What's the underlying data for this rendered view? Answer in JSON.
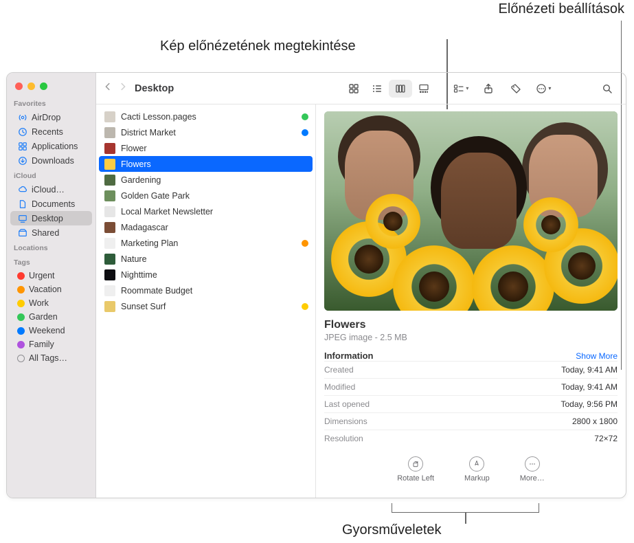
{
  "callouts": {
    "preview_settings": "Előnézeti beállítások",
    "image_preview": "Kép előnézetének megtekintése",
    "quick_actions": "Gyorsműveletek"
  },
  "window": {
    "title": "Desktop"
  },
  "sidebar": {
    "sections": {
      "favorites": "Favorites",
      "icloud": "iCloud",
      "locations": "Locations",
      "tags": "Tags"
    },
    "favorites": [
      {
        "label": "AirDrop",
        "icon": "airdrop"
      },
      {
        "label": "Recents",
        "icon": "clock"
      },
      {
        "label": "Applications",
        "icon": "apps"
      },
      {
        "label": "Downloads",
        "icon": "download"
      }
    ],
    "icloud": [
      {
        "label": "iCloud…",
        "icon": "cloud"
      },
      {
        "label": "Documents",
        "icon": "doc"
      },
      {
        "label": "Desktop",
        "icon": "desktop",
        "selected": true
      },
      {
        "label": "Shared",
        "icon": "shared"
      }
    ],
    "tags": [
      {
        "label": "Urgent",
        "color": "#ff3b30"
      },
      {
        "label": "Vacation",
        "color": "#ff9500"
      },
      {
        "label": "Work",
        "color": "#ffcc00"
      },
      {
        "label": "Garden",
        "color": "#34c759"
      },
      {
        "label": "Weekend",
        "color": "#007aff"
      },
      {
        "label": "Family",
        "color": "#af52de"
      },
      {
        "label": "All Tags…",
        "color": null
      }
    ]
  },
  "files": [
    {
      "name": "Cacti Lesson.pages",
      "icon": "#d7d1c8",
      "tag": "#34c759"
    },
    {
      "name": "District Market",
      "icon": "#bcb7ae",
      "tag": "#007aff"
    },
    {
      "name": "Flower",
      "icon": "#a6352f",
      "tag": null
    },
    {
      "name": "Flowers",
      "icon": "#e4b93d",
      "tag": null,
      "selected": true
    },
    {
      "name": "Gardening",
      "icon": "#4f6b42",
      "tag": null
    },
    {
      "name": "Golden Gate Park",
      "icon": "#6d8f5d",
      "tag": null
    },
    {
      "name": "Local Market Newsletter",
      "icon": "#e6e6e6",
      "tag": null
    },
    {
      "name": "Madagascar",
      "icon": "#7b4d36",
      "tag": null
    },
    {
      "name": "Marketing Plan",
      "icon": "#efefef",
      "tag": "#ff9500"
    },
    {
      "name": "Nature",
      "icon": "#2e5c3a",
      "tag": null
    },
    {
      "name": "Nighttime",
      "icon": "#0e0e12",
      "tag": null
    },
    {
      "name": "Roommate Budget",
      "icon": "#efefef",
      "tag": null
    },
    {
      "name": "Sunset Surf",
      "icon": "#e9c96a",
      "tag": "#ffcc00"
    }
  ],
  "preview": {
    "name": "Flowers",
    "subtitle": "JPEG image - 2.5 MB",
    "info_label": "Information",
    "show_more": "Show More",
    "rows": [
      {
        "k": "Created",
        "v": "Today, 9:41 AM"
      },
      {
        "k": "Modified",
        "v": "Today, 9:41 AM"
      },
      {
        "k": "Last opened",
        "v": "Today, 9:56 PM"
      },
      {
        "k": "Dimensions",
        "v": "2800 x 1800"
      },
      {
        "k": "Resolution",
        "v": "72×72"
      }
    ],
    "quick_actions": [
      {
        "label": "Rotate Left",
        "icon": "rotate"
      },
      {
        "label": "Markup",
        "icon": "markup"
      },
      {
        "label": "More…",
        "icon": "more"
      }
    ]
  }
}
